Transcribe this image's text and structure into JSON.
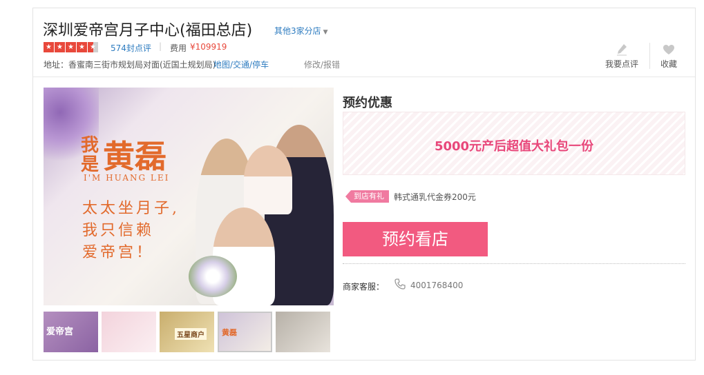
{
  "store": {
    "name": "深圳爱帝宫月子中心(福田总店)",
    "other_branches": "其他3家分店",
    "rating_stars": 4.5,
    "review_count": "574封点评",
    "separator": "|",
    "fee_label": "费用",
    "fee_value": "¥109919",
    "address": "地址：香蜜南三街市规划局对面(近国土规划局)",
    "map_link": "地图/交通/停车",
    "edit_link": "修改/报错"
  },
  "actions": {
    "review_label": "我要点评",
    "favorite_label": "收藏"
  },
  "gallery": {
    "headline_small": "我\n是",
    "headline_big": "黄磊",
    "headline_en": "I'M HUANG LEI",
    "slogan": [
      "太太坐月子,",
      "我只信赖",
      "爱帝宫！"
    ],
    "thumb_labels": [
      "爱帝宫",
      "",
      "五星商户",
      "黄磊",
      ""
    ]
  },
  "booking": {
    "section_title": "预约优惠",
    "promo": "5000元产后超值大礼包一份",
    "gift_tag": "到店有礼",
    "gift_text": "韩式通乳代金券200元",
    "book_button": "预约看店",
    "service_label": "商家客服：",
    "phone": "4001768400"
  },
  "colors": {
    "accent_pink": "#f25a80",
    "promo_text": "#e8477a",
    "link_blue": "#2e7cc0",
    "star_red": "#e8483b",
    "headline_orange": "#e26a2c"
  },
  "icons": {
    "review": "pencil-icon",
    "favorite": "heart-icon",
    "phone": "phone-icon",
    "branches": "chevron-down-icon"
  }
}
